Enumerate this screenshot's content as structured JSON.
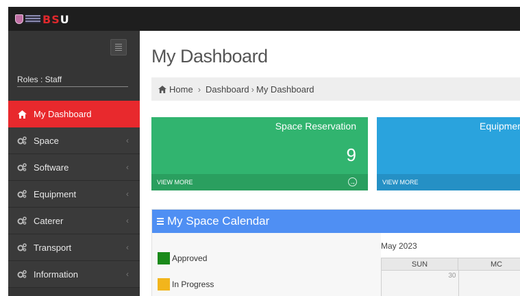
{
  "app": {
    "logo_text_red": "BS",
    "logo_text_white": "U",
    "roles_label": "Roles : Staff"
  },
  "sidebar": {
    "items": [
      {
        "label": "My Dashboard",
        "icon": "home-icon",
        "active": true
      },
      {
        "label": "Space",
        "icon": "cogs-icon"
      },
      {
        "label": "Software",
        "icon": "cogs-icon"
      },
      {
        "label": "Equipment",
        "icon": "cogs-icon"
      },
      {
        "label": "Caterer",
        "icon": "cogs-icon"
      },
      {
        "label": "Transport",
        "icon": "cogs-icon"
      },
      {
        "label": "Information",
        "icon": "cogs-icon"
      }
    ],
    "chevron": "‹"
  },
  "header": {
    "title": "My Dashboard"
  },
  "breadcrumb": {
    "home": "Home",
    "sep1": "›",
    "dashboard": "Dashboard",
    "sep2": "›",
    "current": "My Dashboard"
  },
  "cards": [
    {
      "label": "Space Reservation",
      "count": "9",
      "footer": "VIEW MORE",
      "color": "#31b46f"
    },
    {
      "label": "Equipmer",
      "footer": "VIEW MORE",
      "color": "#2aa3dd"
    }
  ],
  "calendar": {
    "title": "My Space Calendar",
    "legend": [
      {
        "label": "Approved",
        "color": "#1a8a1a"
      },
      {
        "label": "In Progress",
        "color": "#f2b51c"
      }
    ],
    "month": "May 2023",
    "days": [
      "SUN",
      "MC"
    ],
    "first_row_dates": [
      "30",
      ""
    ]
  },
  "colors": {
    "accent_red": "#e8292d",
    "sidebar_bg": "#353535",
    "calendar_header": "#4f8ff3"
  }
}
